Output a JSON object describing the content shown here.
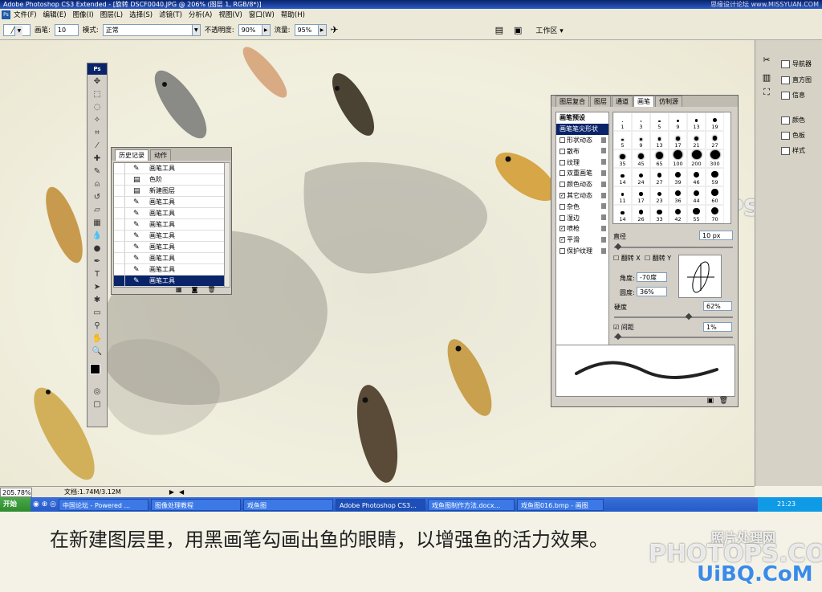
{
  "titlebar": {
    "text": "Adobe Photoshop CS3 Extended - [旋转 DSCF0040.JPG @ 206% (图层 1, RGB/8*)]",
    "watermark": "思缘设计论坛 www.MISSYUAN.COM"
  },
  "menu": [
    "文件(F)",
    "编辑(E)",
    "图像(I)",
    "图层(L)",
    "选择(S)",
    "滤镜(T)",
    "分析(A)",
    "视图(V)",
    "窗口(W)",
    "帮助(H)"
  ],
  "options": {
    "brush_label": "画笔:",
    "brush_size": "10",
    "mode_label": "模式:",
    "mode_value": "正常",
    "opacity_label": "不透明度:",
    "opacity_value": "90%",
    "flow_label": "流量:",
    "flow_value": "95%",
    "workspace": "工作区 ▾"
  },
  "toolbox": {
    "title": "Ps"
  },
  "history": {
    "tabs": [
      "历史记录",
      "动作"
    ],
    "items": [
      "画笔工具",
      "色阶",
      "新建图层",
      "画笔工具",
      "画笔工具",
      "画笔工具",
      "画笔工具",
      "画笔工具",
      "画笔工具",
      "画笔工具",
      "画笔工具"
    ]
  },
  "brush_panel": {
    "tabs": [
      "图层复合",
      "图层",
      "通道",
      "画笔",
      "仿制源"
    ],
    "presets_label": "画笔预设",
    "options": [
      {
        "label": "画笔笔尖形状",
        "checked": null,
        "selected": true
      },
      {
        "label": "形状动态",
        "checked": false
      },
      {
        "label": "散布",
        "checked": false
      },
      {
        "label": "纹理",
        "checked": false
      },
      {
        "label": "双重画笔",
        "checked": false
      },
      {
        "label": "颜色动态",
        "checked": false
      },
      {
        "label": "其它动态",
        "checked": true
      },
      {
        "label": "杂色",
        "checked": false
      },
      {
        "label": "湿边",
        "checked": false
      },
      {
        "label": "喷枪",
        "checked": true
      },
      {
        "label": "平滑",
        "checked": true
      },
      {
        "label": "保护纹理",
        "checked": false
      }
    ],
    "tip_sizes": [
      "1",
      "3",
      "5",
      "9",
      "13",
      "19",
      "5",
      "9",
      "13",
      "17",
      "21",
      "27",
      "35",
      "45",
      "65",
      "100",
      "200",
      "300",
      "14",
      "24",
      "27",
      "39",
      "46",
      "59",
      "11",
      "17",
      "23",
      "36",
      "44",
      "60",
      "14",
      "26",
      "33",
      "42",
      "55",
      "70"
    ],
    "diameter_label": "直径",
    "diameter_value": "10 px",
    "flip_x": "翻转 X",
    "flip_y": "翻转 Y",
    "angle_label": "角度:",
    "angle_value": "-70度",
    "roundness_label": "圆度:",
    "roundness_value": "36%",
    "hardness_label": "硬度",
    "hardness_value": "62%",
    "spacing_label": "间距",
    "spacing_value": "1%"
  },
  "dock": [
    {
      "icon": "navigator-icon",
      "label": "导航器"
    },
    {
      "icon": "histogram-icon",
      "label": "直方图"
    },
    {
      "icon": "info-icon",
      "label": "信息"
    },
    {
      "icon": "color-icon",
      "label": "颜色"
    },
    {
      "icon": "swatches-icon",
      "label": "色板"
    },
    {
      "icon": "styles-icon",
      "label": "样式"
    }
  ],
  "status": {
    "zoom": "205.78%",
    "doc": "文档:1.74M/3.12M"
  },
  "taskbar": {
    "start": "开始",
    "tasks": [
      "中国论坛 - Powered ...",
      "图像处理教程",
      "戏鱼图",
      "Adobe Photoshop CS3...",
      "戏鱼图制作方法.docx...",
      "戏鱼图016.bmp - 画图"
    ],
    "clock": "21:23"
  },
  "caption": "在新建图层里，用黑画笔勾画出鱼的眼睛，以增强鱼的活力效果。",
  "watermarks": {
    "photops_cn": "照片处理网",
    "photops": "PHOTOPS.COM",
    "uibq": "UiBQ.CoM"
  }
}
